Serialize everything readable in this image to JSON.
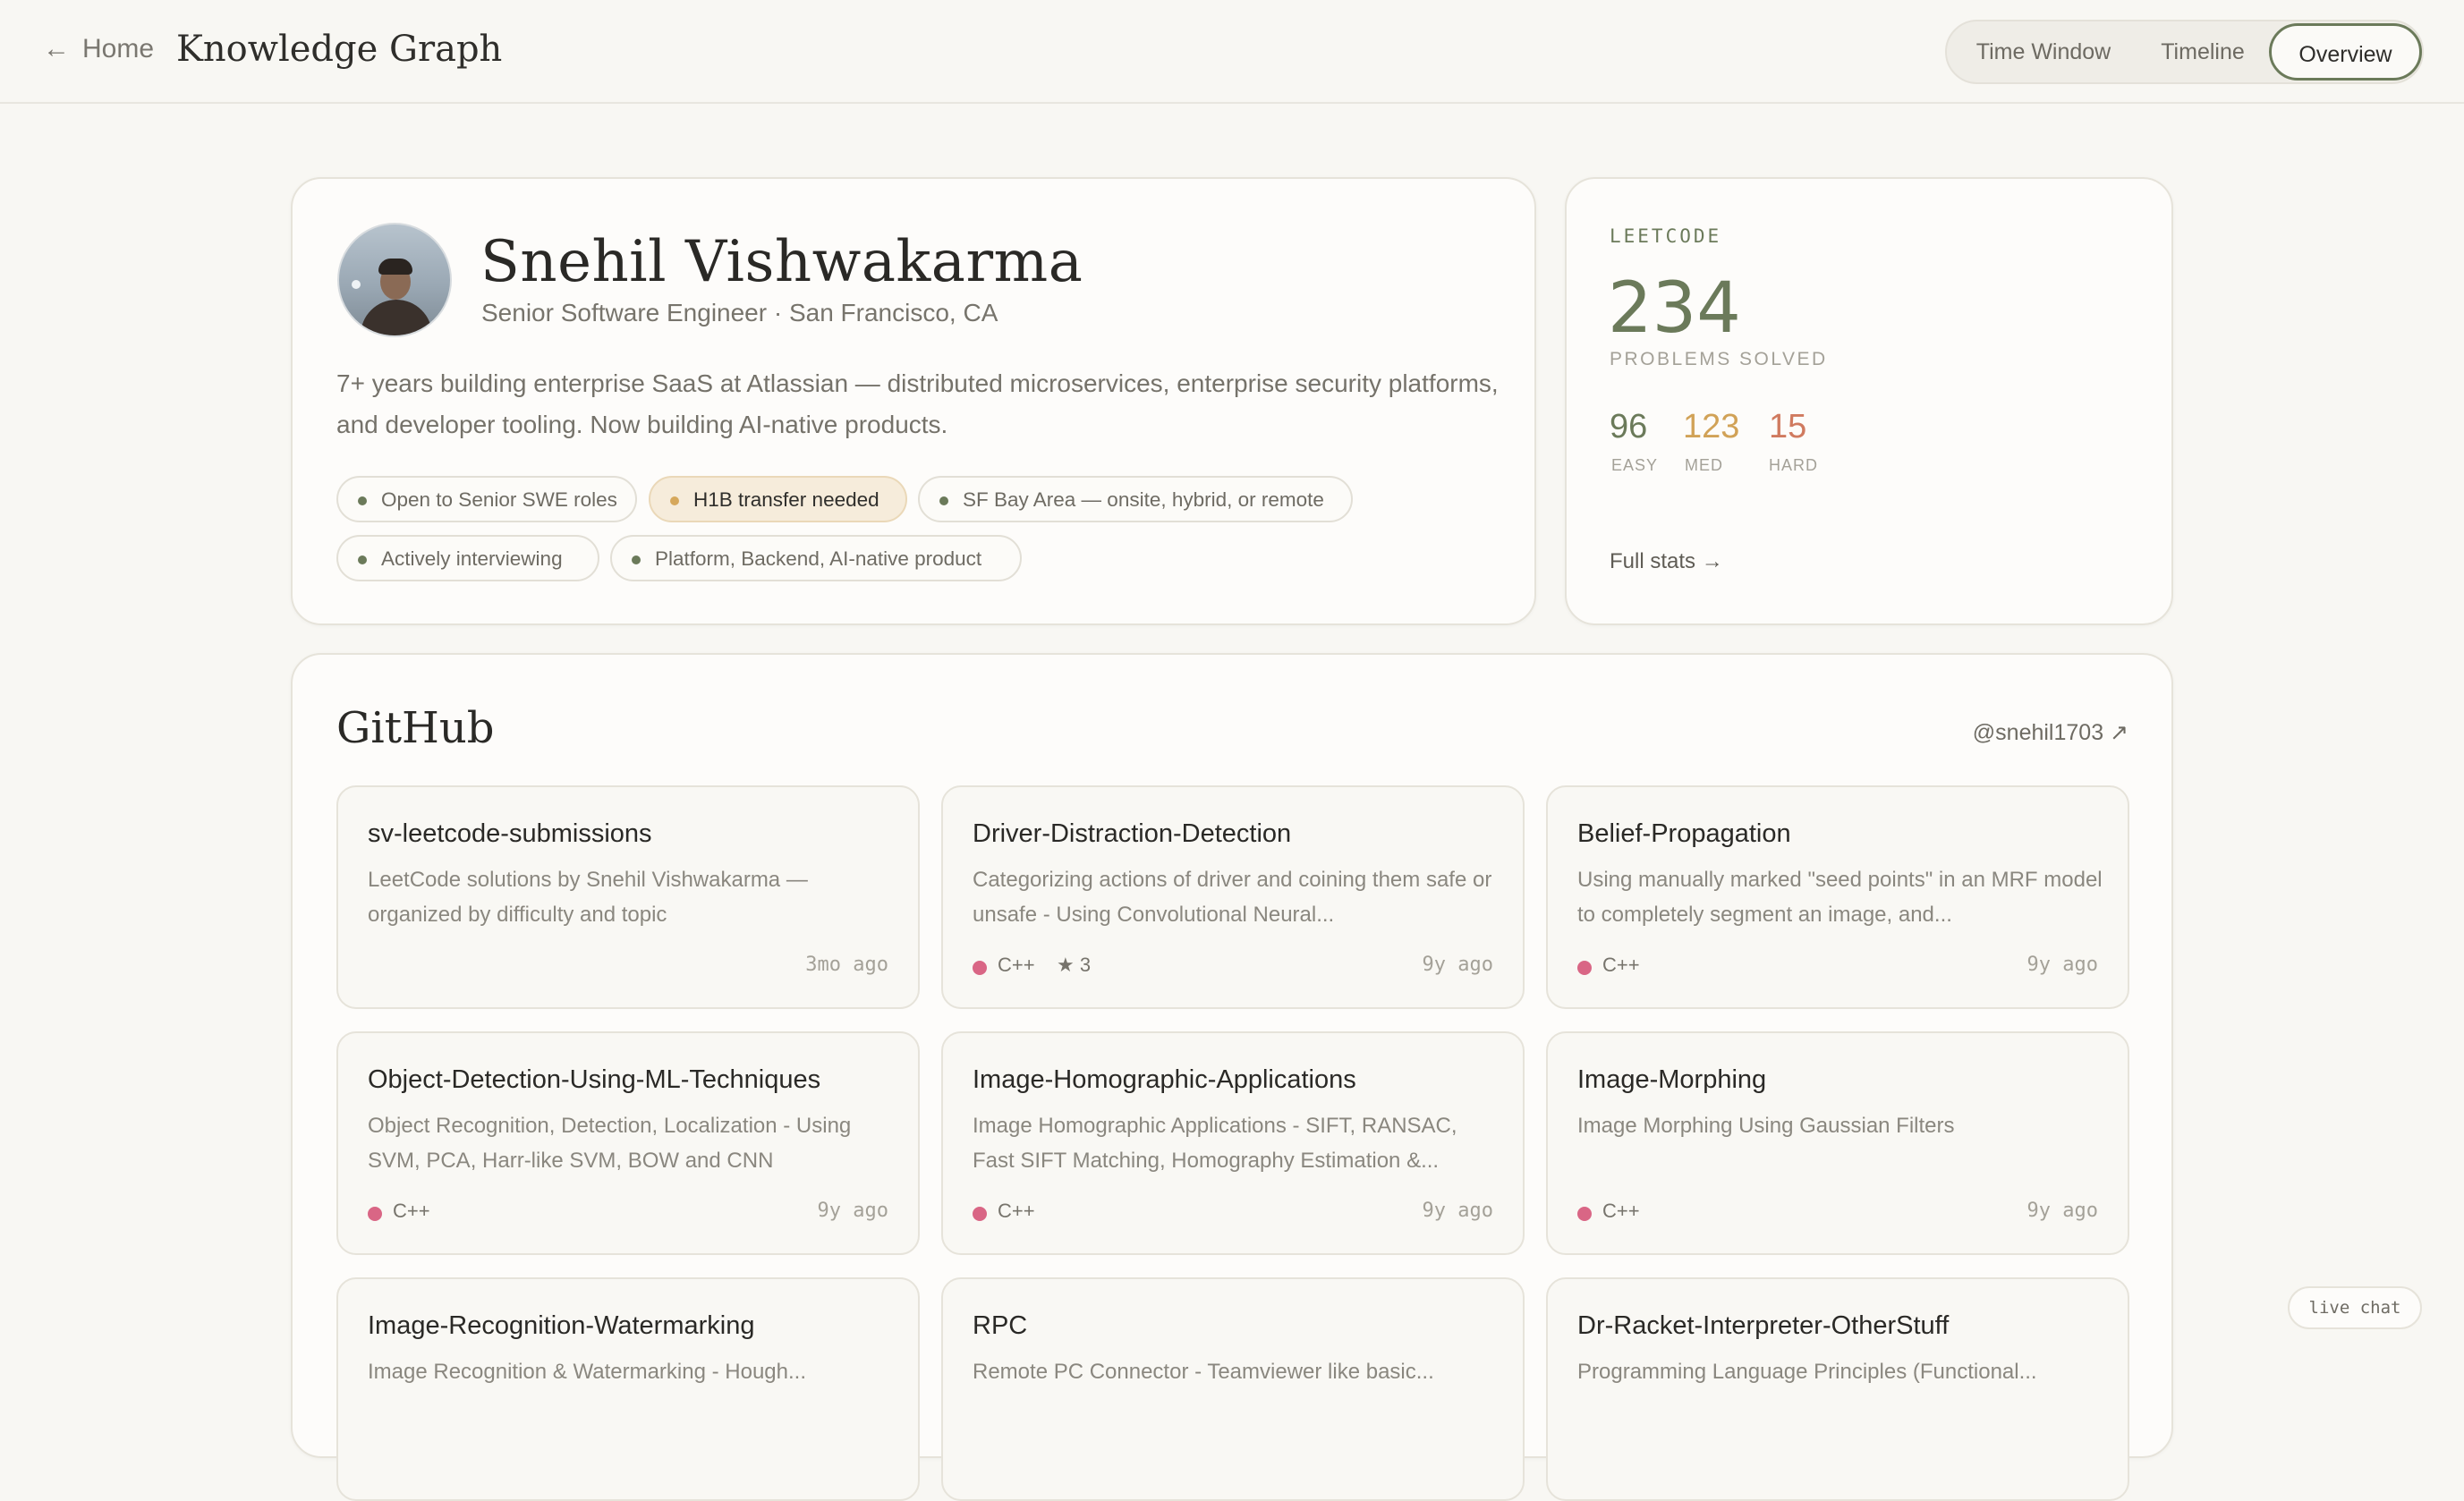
{
  "nav": {
    "back_arrow": "←",
    "home_label": "Home",
    "app_title": "Knowledge Graph",
    "views": [
      "Time Window",
      "Timeline",
      "Overview"
    ],
    "active_view": "Overview"
  },
  "profile": {
    "name": "Snehil Vishwakarma",
    "subtitle": "Senior Software Engineer · San Francisco, CA",
    "bio": "7+ years building enterprise SaaS at Atlassian — distributed microservices, enterprise security platforms, and developer tooling. Now building AI-native products.",
    "tags": [
      {
        "label": "Open to Senior SWE roles",
        "highlight": false
      },
      {
        "label": "H1B transfer needed",
        "highlight": true
      },
      {
        "label": "SF Bay Area — onsite, hybrid, or remote",
        "highlight": false
      },
      {
        "label": "Actively interviewing",
        "highlight": false
      },
      {
        "label": "Platform, Backend, AI-native product",
        "highlight": false
      }
    ]
  },
  "leetcode": {
    "label": "LEETCODE",
    "total": "234",
    "total_label": "PROBLEMS SOLVED",
    "easy": "96",
    "easy_label": "EASY",
    "easy_color": "#6b7a5a",
    "medium": "123",
    "medium_label": "MED",
    "medium_color": "#d1a257",
    "hard": "15",
    "hard_label": "HARD",
    "hard_color": "#d07a5f",
    "link": "Full stats →"
  },
  "github": {
    "title": "GitHub",
    "handle": "@snehil1703 ↗",
    "lang_color": "#d96685",
    "repos": [
      {
        "name": "sv-leetcode-submissions",
        "desc": "LeetCode solutions by Snehil Vishwakarma — organized by difficulty and topic",
        "lang": "",
        "stars": "",
        "time": "3mo ago"
      },
      {
        "name": "Driver-Distraction-Detection",
        "desc": "Categorizing actions of driver and coining them safe or unsafe - Using Convolutional Neural...",
        "lang": "C++",
        "stars": "★ 3",
        "time": "9y ago"
      },
      {
        "name": "Belief-Propagation",
        "desc": "Using manually marked \"seed points\" in an MRF model to completely segment an image, and...",
        "lang": "C++",
        "stars": "",
        "time": "9y ago"
      },
      {
        "name": "Object-Detection-Using-ML-Techniques",
        "desc": "Object Recognition, Detection, Localization - Using SVM, PCA, Harr-like SVM, BOW and CNN",
        "lang": "C++",
        "stars": "",
        "time": "9y ago"
      },
      {
        "name": "Image-Homographic-Applications",
        "desc": "Image Homographic Applications - SIFT, RANSAC, Fast SIFT Matching, Homography Estimation &...",
        "lang": "C++",
        "stars": "",
        "time": "9y ago"
      },
      {
        "name": "Image-Morphing",
        "desc": "Image Morphing Using Gaussian Filters",
        "lang": "C++",
        "stars": "",
        "time": "9y ago"
      },
      {
        "name": "Image-Recognition-Watermarking",
        "desc": "Image Recognition & Watermarking - Hough...",
        "lang": "",
        "stars": "",
        "time": ""
      },
      {
        "name": "RPC",
        "desc": "Remote PC Connector - Teamviewer like basic...",
        "lang": "",
        "stars": "",
        "time": ""
      },
      {
        "name": "Dr-Racket-Interpreter-OtherStuff",
        "desc": "Programming Language Principles (Functional...",
        "lang": "",
        "stars": "",
        "time": ""
      }
    ]
  },
  "live_chat": "live chat"
}
